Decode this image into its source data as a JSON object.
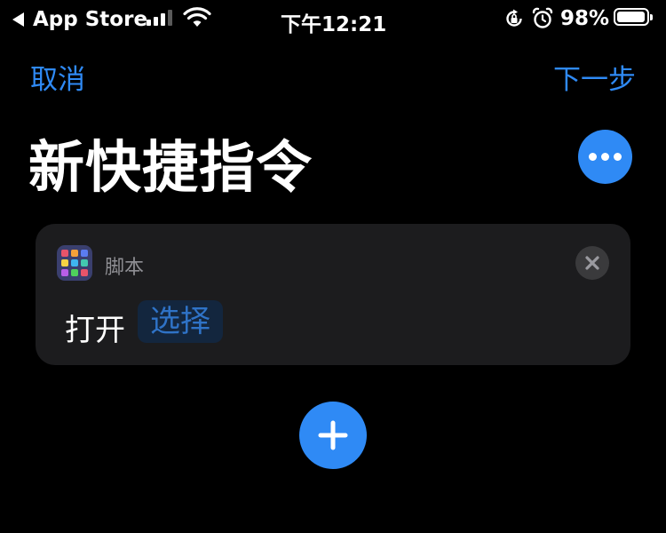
{
  "status_bar": {
    "back_app": "App Store",
    "time": "下午12:21",
    "battery_percent_text": "98%",
    "battery_level": 0.98,
    "signal_bars_active": 3,
    "signal_bars_total": 4,
    "icons": [
      "back-triangle-icon",
      "signal-icon",
      "wifi-icon",
      "rotation-lock-icon",
      "alarm-icon",
      "battery-icon"
    ]
  },
  "nav": {
    "cancel_label": "取消",
    "next_label": "下一步"
  },
  "page": {
    "title": "新快捷指令",
    "more_icon": "ellipsis-icon"
  },
  "action": {
    "category": "脚本",
    "app_icon": "scripting-grid-icon",
    "verb": "打开",
    "parameter": "选择",
    "close_icon": "close-icon"
  },
  "add_icon": "plus-icon",
  "colors": {
    "background": "#000000",
    "accent": "#2f8af5",
    "card": "#1c1c1e",
    "token_bg": "#13263e",
    "token_text": "#2f73c7",
    "secondary_text": "#8e8e93",
    "icon_tiles": [
      "#e8546a",
      "#f5a13a",
      "#5b7cf0",
      "#f6d444",
      "#3fb5f0",
      "#43c9b0",
      "#b85ee8",
      "#4fd05c",
      "#e8546a"
    ]
  }
}
